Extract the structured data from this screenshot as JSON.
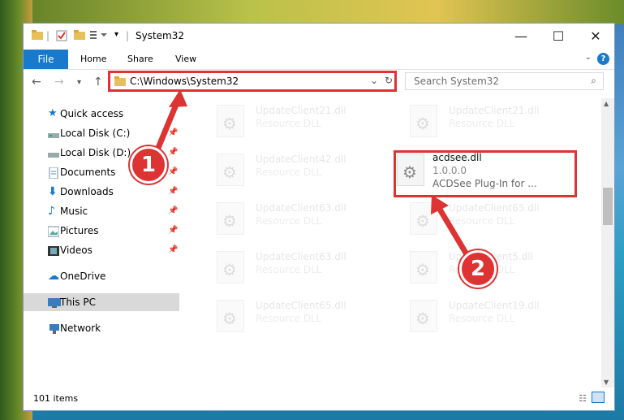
{
  "window": {
    "title": "System32"
  },
  "ribbon": {
    "tabs": [
      "File",
      "Home",
      "Share",
      "View"
    ]
  },
  "nav": {
    "back": "←",
    "forward": "→",
    "recent": "▾",
    "up": "↑",
    "address": "C:\\Windows\\System32",
    "search_placeholder": "Search System32"
  },
  "sidebar": {
    "items": [
      {
        "label": "Quick access",
        "icon": "star-icon"
      },
      {
        "label": "Local Disk (C:)",
        "icon": "drive-icon"
      },
      {
        "label": "Local Disk (D:)",
        "icon": "drive-icon"
      },
      {
        "label": "Documents",
        "icon": "documents-icon"
      },
      {
        "label": "Downloads",
        "icon": "downloads-icon"
      },
      {
        "label": "Music",
        "icon": "music-icon"
      },
      {
        "label": "Pictures",
        "icon": "pictures-icon"
      },
      {
        "label": "Videos",
        "icon": "videos-icon"
      },
      {
        "label": "OneDrive",
        "icon": "cloud-icon"
      },
      {
        "label": "This PC",
        "icon": "computer-icon"
      },
      {
        "label": "Network",
        "icon": "network-icon"
      }
    ]
  },
  "files": [
    {
      "name": "UpdateClient21.dll",
      "desc": "Resource DLL"
    },
    {
      "name": "UpdateClient21.dll",
      "desc": "Resource DLL"
    },
    {
      "name": "UpdateClient42.dll",
      "desc": "Resource DLL"
    },
    {
      "name": "acdsee.dll",
      "desc": "1.0.0.0",
      "extra": "ACDSee Plug-In for ..."
    },
    {
      "name": "UpdateClient63.dll",
      "desc": "Resource DLL"
    },
    {
      "name": "UpdateClient65.dll",
      "desc": "Resource DLL"
    },
    {
      "name": "UpdateClient63.dll",
      "desc": "Resource DLL"
    },
    {
      "name": "UpdateClient5.dll",
      "desc": "Resource DLL"
    },
    {
      "name": "UpdateClient65.dll",
      "desc": "Resource DLL"
    },
    {
      "name": "UpdateClient19.dll",
      "desc": "Resource DLL"
    }
  ],
  "status": {
    "count": "101 items"
  },
  "callouts": [
    "1",
    "2"
  ],
  "colors": {
    "accent": "#1979ca",
    "highlight": "#dd3333"
  }
}
